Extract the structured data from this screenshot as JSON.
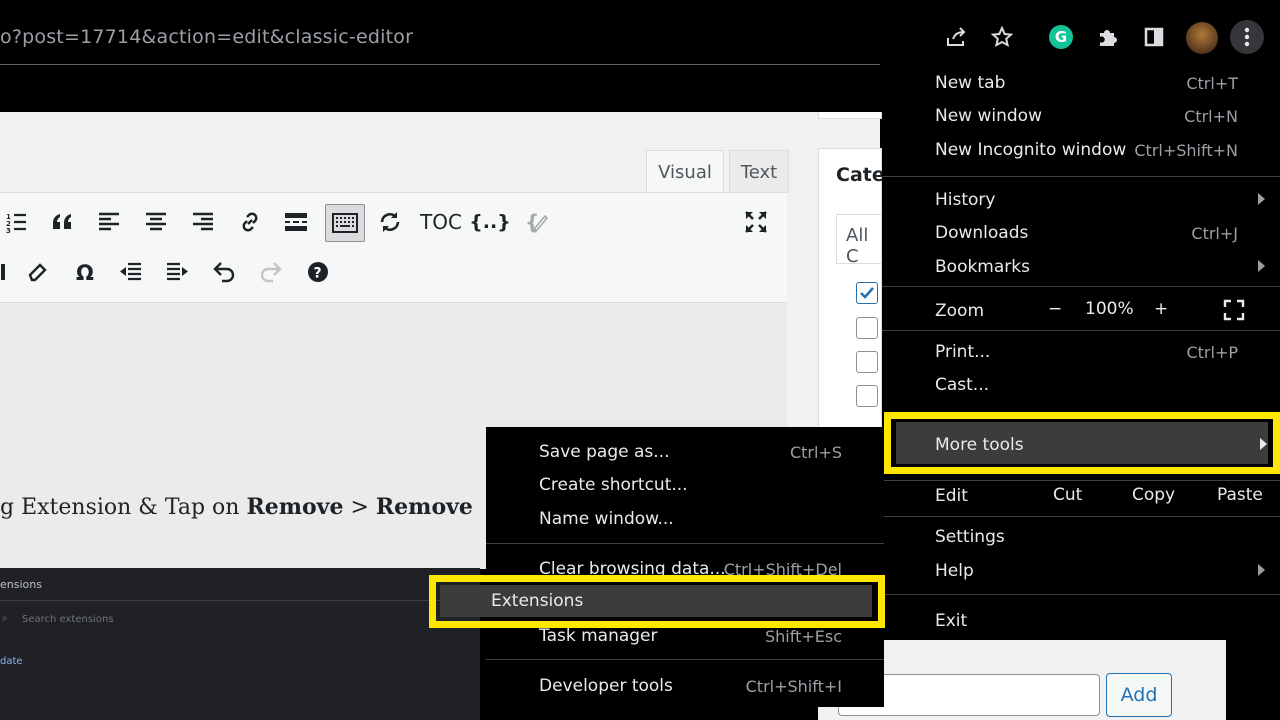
{
  "browser": {
    "url": "o?post=17714&action=edit&classic-editor",
    "toolbar_icons": [
      "share-icon",
      "star-icon",
      "grammarly-icon",
      "puzzle-icon",
      "sidebar-icon",
      "avatar",
      "more-vert-icon"
    ],
    "grammarly_letter": "G"
  },
  "editor": {
    "tabs": {
      "visual": "Visual",
      "text": "Text"
    },
    "toc_label": "TOC",
    "code_label": "{..}",
    "body_text": {
      "prefix": "g Extension & Tap on ",
      "bold1": "Remove",
      "sep": " > ",
      "bold2": "Remove"
    }
  },
  "sidebar": {
    "categories_title": "Categ",
    "all_tab": "All C",
    "add_button": "Add"
  },
  "extensions_page": {
    "title": "ensions",
    "search_placeholder": "Search extensions",
    "update_link": "date"
  },
  "main_menu": {
    "new_tab": {
      "label": "New tab",
      "shortcut": "Ctrl+T"
    },
    "new_window": {
      "label": "New window",
      "shortcut": "Ctrl+N"
    },
    "incognito": {
      "label": "New Incognito window",
      "shortcut": "Ctrl+Shift+N"
    },
    "history": {
      "label": "History"
    },
    "downloads": {
      "label": "Downloads",
      "shortcut": "Ctrl+J"
    },
    "bookmarks": {
      "label": "Bookmarks"
    },
    "zoom": {
      "label": "Zoom",
      "minus": "−",
      "value": "100%",
      "plus": "+"
    },
    "print": {
      "label": "Print...",
      "shortcut": "Ctrl+P"
    },
    "cast": {
      "label": "Cast..."
    },
    "more_tools": {
      "label": "More tools"
    },
    "edit": {
      "label": "Edit",
      "cut": "Cut",
      "copy": "Copy",
      "paste": "Paste"
    },
    "settings": {
      "label": "Settings"
    },
    "help": {
      "label": "Help"
    },
    "exit": {
      "label": "Exit"
    }
  },
  "more_tools_menu": {
    "save_page": {
      "label": "Save page as...",
      "shortcut": "Ctrl+S"
    },
    "create_shortcut": {
      "label": "Create shortcut..."
    },
    "name_window": {
      "label": "Name window..."
    },
    "clear_data": {
      "label": "Clear browsing data...",
      "shortcut": "Ctrl+Shift+Del"
    },
    "extensions": {
      "label": "Extensions"
    },
    "task_manager": {
      "label": "Task manager",
      "shortcut": "Shift+Esc"
    },
    "dev_tools": {
      "label": "Developer tools",
      "shortcut": "Ctrl+Shift+I"
    }
  },
  "colors": {
    "highlight": "#ffe600",
    "menu_bg": "#000000",
    "selected_bg": "#3c3c3c"
  }
}
